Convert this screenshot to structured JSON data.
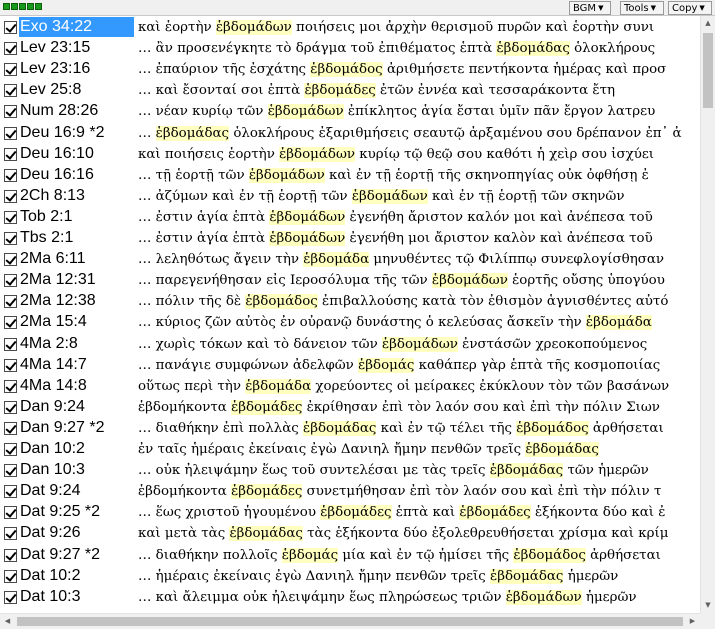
{
  "toolbar": {
    "bgm_label": "BGM",
    "tools_label": "Tools",
    "copy_label": "Copy"
  },
  "icons": {
    "dropdown": "chevron-down-icon",
    "grip": "status-squares-icon",
    "checkbox": "checkmark-icon"
  },
  "colors": {
    "selection": "#3399ff",
    "highlight": "#ffffc0",
    "grip": "#1a9a1a"
  },
  "selected_index": 0,
  "rows": [
    {
      "ref": "Exo 34:22",
      "pre": "καὶ ἑορτὴν ",
      "hit": "ἑβδομάδων",
      "post": " ποιήσεις μοι ἀρχὴν θερισμοῦ πυρῶν καὶ ἑορτὴν συνι"
    },
    {
      "ref": "Lev 23:15",
      "pre": "… ἂν προσενέγκητε τὸ δράγμα τοῦ ἐπιθέματος ἑπτὰ ",
      "hit": "ἑβδομάδας",
      "post": " ὁλοκλήρους"
    },
    {
      "ref": "Lev 23:16",
      "pre": "… ἐπαύριον τῆς ἐσχάτης ",
      "hit": "ἑβδομάδος",
      "post": " ἀριθμήσετε πεντήκοντα ἡμέρας καὶ προσ"
    },
    {
      "ref": "Lev 25:8",
      "pre": "… καὶ ἔσονταί σοι ἑπτὰ ",
      "hit": "ἑβδομάδες",
      "post": " ἐτῶν ἐννέα καὶ τεσσαράκοντα ἔτη"
    },
    {
      "ref": "Num 28:26",
      "pre": "… νέαν κυρίῳ τῶν ",
      "hit": "ἑβδομάδων",
      "post": " ἐπίκλητος ἁγία ἔσται ὑμῖν πᾶν ἔργον λατρευ"
    },
    {
      "ref": "Deu 16:9 *2",
      "pre": "… ",
      "hit": "ἑβδομάδας",
      "post": " ὁλοκλήρους ἐξαριθμήσεις σεαυτῷ ἀρξαμένου σου δρέπανον ἐπ᾽ ἀ"
    },
    {
      "ref": "Deu 16:10",
      "pre": "καὶ ποιήσεις ἑορτὴν ",
      "hit": "ἑβδομάδων",
      "post": " κυρίῳ τῷ θεῷ σου καθότι ἡ χεὶρ σου ἰσχύει"
    },
    {
      "ref": "Deu 16:16",
      "pre": "… τῇ ἑορτῇ τῶν ",
      "hit": "ἑβδομάδων",
      "post": " καὶ ἐν τῇ ἑορτῇ τῆς σκηνοπηγίας οὐκ ὀφθήσῃ ἐ"
    },
    {
      "ref": "2Ch 8:13",
      "pre": "… ἀζύμων καὶ ἐν τῇ ἑορτῇ τῶν ",
      "hit": "ἑβδομάδων",
      "post": " καὶ ἐν τῇ ἑορτῇ τῶν σκηνῶν"
    },
    {
      "ref": "Tob 2:1",
      "pre": "… ἐστιν ἁγία ἑπτὰ ",
      "hit": "ἑβδομάδων",
      "post": " ἐγενήθη ἄριστον καλόν μοι καὶ ἀνέπεσα τοῦ"
    },
    {
      "ref": "Tbs 2:1",
      "pre": "… ἐστιν ἁγία ἑπτὰ ",
      "hit": "ἑβδομάδων",
      "post": " ἐγενήθη μοι ἄριστον καλὸν καὶ ἀνέπεσα τοῦ"
    },
    {
      "ref": "2Ma 6:11",
      "pre": "… λεληθότως ἄγειν τὴν ",
      "hit": "ἑβδομάδα",
      "post": " μηνυθέντες τῷ Φιλίππῳ συνεφλογίσθησαν"
    },
    {
      "ref": "2Ma 12:31",
      "pre": "… παρεγενήθησαν εἰς Ιεροσόλυμα τῆς τῶν ",
      "hit": "ἑβδομάδων",
      "post": " ἑορτῆς οὔσης ὑπογύου"
    },
    {
      "ref": "2Ma 12:38",
      "pre": "… πόλιν τῆς δὲ ",
      "hit": "ἑβδομάδος",
      "post": " ἐπιβαλλούσης κατὰ τὸν ἐθισμὸν ἁγνισθέντες αὐτό"
    },
    {
      "ref": "2Ma 15:4",
      "pre": "… κύριος ζῶν αὐτὸς ἐν οὐρανῷ δυνάστης ὁ κελεύσας ἄσκεῖν τὴν ",
      "hit": "ἑβδομάδα",
      "post": ""
    },
    {
      "ref": "4Ma 2:8",
      "pre": "… χωρὶς τόκων καὶ τὸ δάνειον τῶν ",
      "hit": "ἑβδομάδων",
      "post": " ἐνστάσῶν χρεοκοπούμενος"
    },
    {
      "ref": "4Ma 14:7",
      "pre": "… πανάγιε συμφώνων ἀδελφῶν ",
      "hit": "ἑβδομάς",
      "post": " καθάπερ γὰρ ἑπτὰ τῆς κοσμοποιίας"
    },
    {
      "ref": "4Ma 14:8",
      "pre": "οὕτως περὶ τὴν ",
      "hit": "ἑβδομάδα",
      "post": " χορεύοντες οἱ μείρακες ἐκύκλουν τὸν τῶν βασάνων"
    },
    {
      "ref": "Dan 9:24",
      "pre": "ἑβδομήκοντα ",
      "hit": "ἑβδομάδες",
      "post": " ἐκρίθησαν ἐπὶ τὸν λαόν σου καὶ ἐπὶ τὴν πόλιν Σιων"
    },
    {
      "ref": "Dan 9:27 *2",
      "pre": "… διαθήκην ἐπὶ πολλὰς ",
      "hit": "ἑβδομάδας",
      "post": " καὶ ἐν τῷ τέλει τῆς ",
      "hit2": "ἑβδομάδος",
      "post2": " ἀρθήσεται"
    },
    {
      "ref": "Dan 10:2",
      "pre": "ἐν ταῖς ἡμέραις ἐκείναις ἐγὼ Δανιηλ ἤμην πενθῶν τρεῖς ",
      "hit": "ἑβδομάδας",
      "post": ""
    },
    {
      "ref": "Dan 10:3",
      "pre": "… οὐκ ἠλειψάμην ἕως τοῦ συντελέσαι με τὰς τρεῖς ",
      "hit": "ἑβδομάδας",
      "post": " τῶν ἡμερῶν"
    },
    {
      "ref": "Dat 9:24",
      "pre": "ἑβδομήκοντα ",
      "hit": "ἑβδομάδες",
      "post": " συνετμήθησαν ἐπὶ τὸν λαόν σου καὶ ἐπὶ τὴν πόλιν τ"
    },
    {
      "ref": "Dat 9:25 *2",
      "pre": "… ἕως χριστοῦ ἡγουμένου ",
      "hit": "ἑβδομάδες",
      "post": " ἑπτὰ καὶ ",
      "hit2": "ἑβδομάδες",
      "post2": " ἑξήκοντα δύο καὶ ἐ"
    },
    {
      "ref": "Dat 9:26",
      "pre": "καὶ μετὰ τὰς ",
      "hit": "ἑβδομάδας",
      "post": " τὰς ἑξήκοντα δύο ἐξολεθρευθήσεται χρίσμα καὶ κρίμ"
    },
    {
      "ref": "Dat 9:27 *2",
      "pre": "… διαθήκην πολλοῖς ",
      "hit": "ἑβδομάς",
      "post": " μία καὶ ἐν τῷ ἡμίσει τῆς ",
      "hit2": "ἑβδομάδος",
      "post2": " ἀρθήσεται"
    },
    {
      "ref": "Dat 10:2",
      "pre": "… ἡμέραις ἐκείναις ἐγὼ Δανιηλ ἤμην πενθῶν τρεῖς ",
      "hit": "ἑβδομάδας",
      "post": " ἡμερῶν"
    },
    {
      "ref": "Dat 10:3",
      "pre": "… καὶ ἄλειμμα οὐκ ἠλειψάμην ἕως πληρώσεως τριῶν ",
      "hit": "ἑβδομάδων",
      "post": " ἡμερῶν"
    }
  ]
}
